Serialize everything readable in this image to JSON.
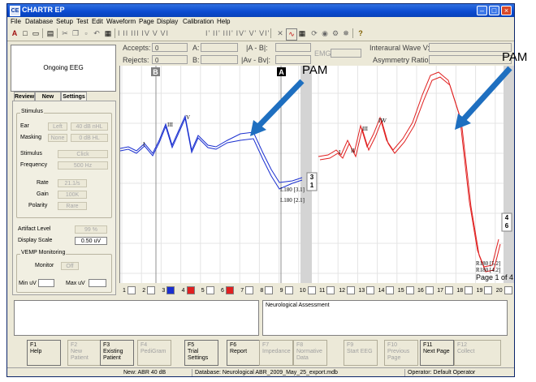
{
  "window": {
    "title": "CHARTR EP",
    "icon_label": "CE",
    "buttons": [
      "minimize-icon",
      "maximize-icon",
      "close-icon"
    ]
  },
  "menu": [
    "File",
    "Database",
    "Setup",
    "Test",
    "Edit",
    "Waveform",
    "Page",
    "Display",
    "Calibration",
    "Help"
  ],
  "header": {
    "ongoing_label": "Ongoing EEG",
    "accepts_label": "Accepts:",
    "accepts_value": "0",
    "rejects_label": "Rejects:",
    "rejects_value": "0",
    "a_label": "A:",
    "b_label": "B:",
    "ab_diff_label": "|A - B|:",
    "avbv_label": "|Av - Bv|:",
    "emg_label": "EMG:",
    "interaural_label": "Interaural Wave V:",
    "asymmetry_label": "Asymmetry Ratio:"
  },
  "tabs": [
    "Review",
    "New Test",
    "Settings"
  ],
  "stimulus": {
    "group_title": "Stimulus",
    "ear_label": "Ear",
    "ear_value": "Left",
    "ear_level": "40 dB nHL",
    "masking_label": "Masking",
    "masking_value": "None",
    "masking_level": "0 dB HL",
    "stimulus_label": "Stimulus",
    "stimulus_value": "Click",
    "frequency_label": "Frequency",
    "frequency_value": "500 Hz",
    "rate_label": "Rate",
    "rate_value": "21.1/s",
    "gain_label": "Gain",
    "gain_value": "100K",
    "polarity_label": "Polarity",
    "polarity_value": "Rare"
  },
  "artifact": {
    "label": "Artifact Level",
    "value": "99 %"
  },
  "display_scale": {
    "label": "Display Scale",
    "value": "0.50 uV"
  },
  "vemp": {
    "group_title": "VEMP Monitoring",
    "monitor_label": "Monitor",
    "monitor_value": "Off",
    "min_label": "Min uV",
    "max_label": "Max uV"
  },
  "plot": {
    "cursor_a": "A",
    "cursor_b": "B",
    "left_peaks": [
      "I",
      "III",
      "V"
    ],
    "right_peaks": [
      "I",
      "II",
      "III",
      "IV",
      "V"
    ],
    "left_annotations": [
      "L180 [3.1]",
      "L180 [2.1]"
    ],
    "right_annotations": [
      "R180 [5.2]",
      "R180 [4.2]"
    ],
    "left_track_labels": [
      "3",
      "1"
    ],
    "right_track_labels": [
      "4",
      "6"
    ],
    "page": "Page 1 of 4",
    "left_color": "#1a2fd0",
    "right_color": "#e02020"
  },
  "tracks": [
    {
      "num": "1",
      "color": "#ffffff"
    },
    {
      "num": "2",
      "color": "#ffffff"
    },
    {
      "num": "3",
      "color": "#1a2fd0"
    },
    {
      "num": "4",
      "color": "#e02020"
    },
    {
      "num": "5",
      "color": "#ffffff"
    },
    {
      "num": "6",
      "color": "#e02020"
    },
    {
      "num": "7",
      "color": "#ffffff"
    },
    {
      "num": "8",
      "color": "#ffffff"
    },
    {
      "num": "9",
      "color": "#ffffff"
    },
    {
      "num": "10",
      "color": "#ffffff"
    },
    {
      "num": "11",
      "color": "#ffffff"
    },
    {
      "num": "12",
      "color": "#ffffff"
    },
    {
      "num": "13",
      "color": "#ffffff"
    },
    {
      "num": "14",
      "color": "#ffffff"
    },
    {
      "num": "15",
      "color": "#ffffff"
    },
    {
      "num": "16",
      "color": "#ffffff"
    },
    {
      "num": "17",
      "color": "#ffffff"
    },
    {
      "num": "18",
      "color": "#ffffff"
    },
    {
      "num": "19",
      "color": "#ffffff"
    },
    {
      "num": "20",
      "color": "#ffffff"
    }
  ],
  "notes": {
    "right_text": "Neurological Assessment"
  },
  "fkeys": [
    {
      "key": "F1",
      "label": "Help",
      "on": true
    },
    {
      "key": "F2",
      "label": "New Patient",
      "on": false
    },
    {
      "key": "F3",
      "label": "Existing Patient",
      "on": true
    },
    {
      "key": "F4",
      "label": "PediGram",
      "on": false
    },
    {
      "key": "F5",
      "label": "Trial Settings",
      "on": true
    },
    {
      "key": "F6",
      "label": "Report",
      "on": true
    },
    {
      "key": "F7",
      "label": "Impedance",
      "on": false
    },
    {
      "key": "F8",
      "label": "Normative Data",
      "on": false
    },
    {
      "key": "F9",
      "label": "Start EEG",
      "on": false
    },
    {
      "key": "F10",
      "label": "Previous Page",
      "on": false
    },
    {
      "key": "F11",
      "label": "Next Page",
      "on": true
    },
    {
      "key": "F12",
      "label": "Collect",
      "on": false
    }
  ],
  "status": {
    "test": "New: ABR 40 dB",
    "database": "Database: Neurological ABR_2009_May_25_export.mdb",
    "operator": "Operator: Default Operator"
  },
  "callouts": [
    "PAM",
    "PAM"
  ]
}
